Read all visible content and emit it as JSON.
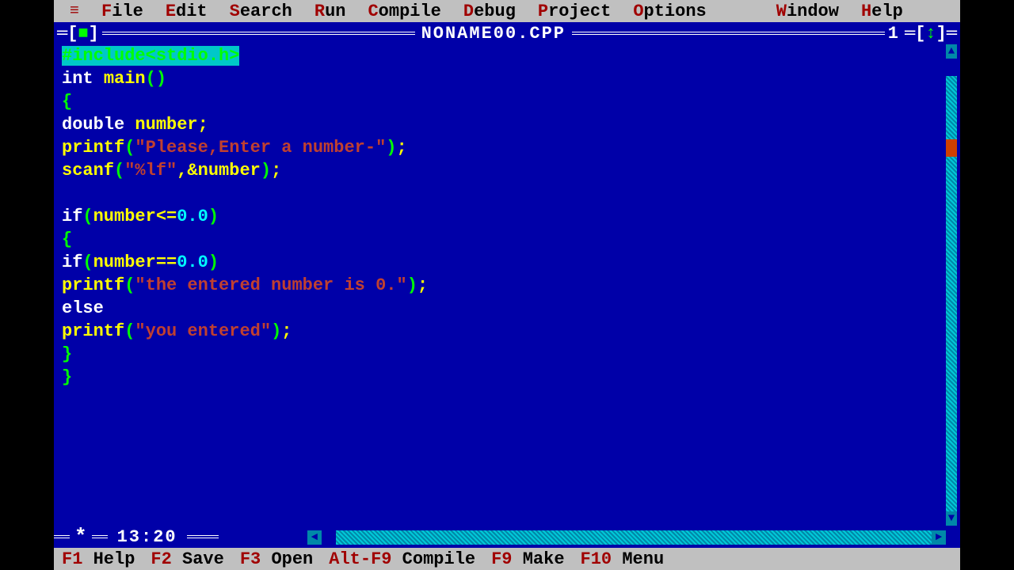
{
  "menubar": {
    "items": [
      {
        "hotkey": "F",
        "rest": "ile"
      },
      {
        "hotkey": "E",
        "rest": "dit"
      },
      {
        "hotkey": "S",
        "rest": "earch"
      },
      {
        "hotkey": "R",
        "rest": "un"
      },
      {
        "hotkey": "C",
        "rest": "ompile"
      },
      {
        "hotkey": "D",
        "rest": "ebug"
      },
      {
        "hotkey": "P",
        "rest": "roject"
      },
      {
        "hotkey": "O",
        "rest": "ptions"
      },
      {
        "hotkey": "W",
        "rest": "indow"
      },
      {
        "hotkey": "H",
        "rest": "elp"
      }
    ]
  },
  "window": {
    "title": "NONAME00.CPP",
    "number": "1",
    "cursor_pos": "13:20"
  },
  "code": {
    "lines": [
      {
        "selected": true,
        "tokens": [
          {
            "t": "#include<stdio.h>",
            "c": "pre"
          }
        ]
      },
      {
        "tokens": [
          {
            "t": "int ",
            "c": "kw"
          },
          {
            "t": "main",
            "c": "id"
          },
          {
            "t": "()",
            "c": "paren"
          }
        ]
      },
      {
        "tokens": [
          {
            "t": "{",
            "c": "brace"
          }
        ]
      },
      {
        "tokens": [
          {
            "t": "double ",
            "c": "kw"
          },
          {
            "t": "number",
            "c": "id"
          },
          {
            "t": ";",
            "c": "punc"
          }
        ]
      },
      {
        "tokens": [
          {
            "t": "printf",
            "c": "fn"
          },
          {
            "t": "(",
            "c": "paren"
          },
          {
            "t": "\"Please,Enter a number-\"",
            "c": "str"
          },
          {
            "t": ")",
            "c": "paren"
          },
          {
            "t": ";",
            "c": "punc"
          }
        ]
      },
      {
        "tokens": [
          {
            "t": "scanf",
            "c": "fn"
          },
          {
            "t": "(",
            "c": "paren"
          },
          {
            "t": "\"%lf\"",
            "c": "str"
          },
          {
            "t": ",&number",
            "c": "id"
          },
          {
            "t": ")",
            "c": "paren"
          },
          {
            "t": ";",
            "c": "punc"
          }
        ]
      },
      {
        "tokens": []
      },
      {
        "tokens": [
          {
            "t": "if",
            "c": "kw"
          },
          {
            "t": "(",
            "c": "paren"
          },
          {
            "t": "number<=",
            "c": "id"
          },
          {
            "t": "0.0",
            "c": "num"
          },
          {
            "t": ")",
            "c": "paren"
          }
        ]
      },
      {
        "tokens": [
          {
            "t": "{",
            "c": "brace"
          }
        ]
      },
      {
        "tokens": [
          {
            "t": "if",
            "c": "kw"
          },
          {
            "t": "(",
            "c": "paren"
          },
          {
            "t": "number==",
            "c": "id"
          },
          {
            "t": "0.0",
            "c": "num"
          },
          {
            "t": ")",
            "c": "paren"
          }
        ]
      },
      {
        "tokens": [
          {
            "t": "printf",
            "c": "fn"
          },
          {
            "t": "(",
            "c": "paren"
          },
          {
            "t": "\"the entered number is 0.\"",
            "c": "str"
          },
          {
            "t": ")",
            "c": "paren"
          },
          {
            "t": ";",
            "c": "punc"
          }
        ]
      },
      {
        "tokens": [
          {
            "t": "else",
            "c": "kw"
          }
        ]
      },
      {
        "tokens": [
          {
            "t": "printf",
            "c": "fn"
          },
          {
            "t": "(",
            "c": "paren"
          },
          {
            "t": "\"you entered\"",
            "c": "str"
          },
          {
            "t": ")",
            "c": "paren"
          },
          {
            "t": ";",
            "c": "punc"
          }
        ]
      },
      {
        "tokens": [
          {
            "t": "}",
            "c": "brace"
          }
        ]
      },
      {
        "tokens": [
          {
            "t": "}",
            "c": "brace"
          }
        ]
      }
    ]
  },
  "statusbar": {
    "items": [
      {
        "key": "F1",
        "label": " Help"
      },
      {
        "key": "F2",
        "label": " Save"
      },
      {
        "key": "F3",
        "label": " Open"
      },
      {
        "key": "Alt-F9",
        "label": " Compile"
      },
      {
        "key": "F9",
        "label": " Make"
      },
      {
        "key": "F10",
        "label": " Menu"
      }
    ]
  }
}
